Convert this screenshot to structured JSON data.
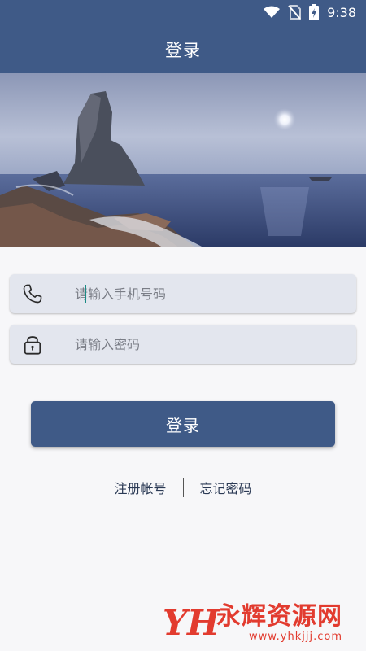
{
  "status_bar": {
    "time": "9:38",
    "icons": [
      "wifi-icon",
      "no-sim-icon",
      "battery-charging-icon"
    ]
  },
  "app_bar": {
    "title": "登录",
    "color": "#3f5a87"
  },
  "hero": {
    "image": "sea-rock-landscape"
  },
  "phone_field": {
    "icon": "phone-icon",
    "value": "",
    "placeholder": "请输入手机号码"
  },
  "password_field": {
    "icon": "lock-icon",
    "value": "",
    "placeholder": "请输入密码"
  },
  "login_button": {
    "label": "登录"
  },
  "links": {
    "register": "注册帐号",
    "forgot_password": "忘记密码"
  },
  "watermark": {
    "logo": "YH",
    "title": "永辉资源网",
    "url": "www.yhkjjj.com",
    "color": "#e23b2f"
  }
}
